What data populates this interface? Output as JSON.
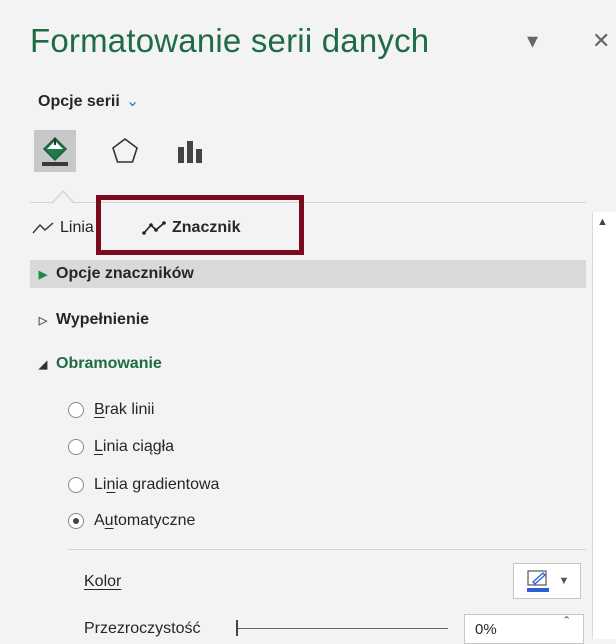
{
  "header": {
    "title": "Formatowanie serii danych",
    "dropdown_icon": "▾",
    "close_icon": "✕"
  },
  "series_options": {
    "label": "Opcje serii",
    "chevron": "⌄"
  },
  "icon_tabs": [
    {
      "name": "fill-line-icon",
      "active": true
    },
    {
      "name": "effects-icon",
      "active": false
    },
    {
      "name": "series-options-icon",
      "active": false
    }
  ],
  "subtabs": {
    "line_label": "Linia",
    "marker_label": "Znacznik"
  },
  "sections": {
    "marker_options": "Opcje znaczników",
    "fill": "Wypełnienie",
    "border": "Obramowanie"
  },
  "border_options": {
    "no_line_first": "B",
    "no_line_rest": "rak linii",
    "solid_first": "L",
    "solid_rest": "inia ciągła",
    "gradient_a": "Li",
    "gradient_ul": "n",
    "gradient_b": "ia gradientowa",
    "auto_a": "A",
    "auto_ul": "u",
    "auto_b": "tomatyczne",
    "selected": "Automatyczne"
  },
  "color": {
    "label_first": "K",
    "label_rest": "olor",
    "swatch": "#2b5fd6"
  },
  "transparency": {
    "label": "Przezroczystość",
    "value": "0%"
  },
  "colors": {
    "accent": "#1e6b45",
    "highlight_box": "#7a0b1f"
  }
}
